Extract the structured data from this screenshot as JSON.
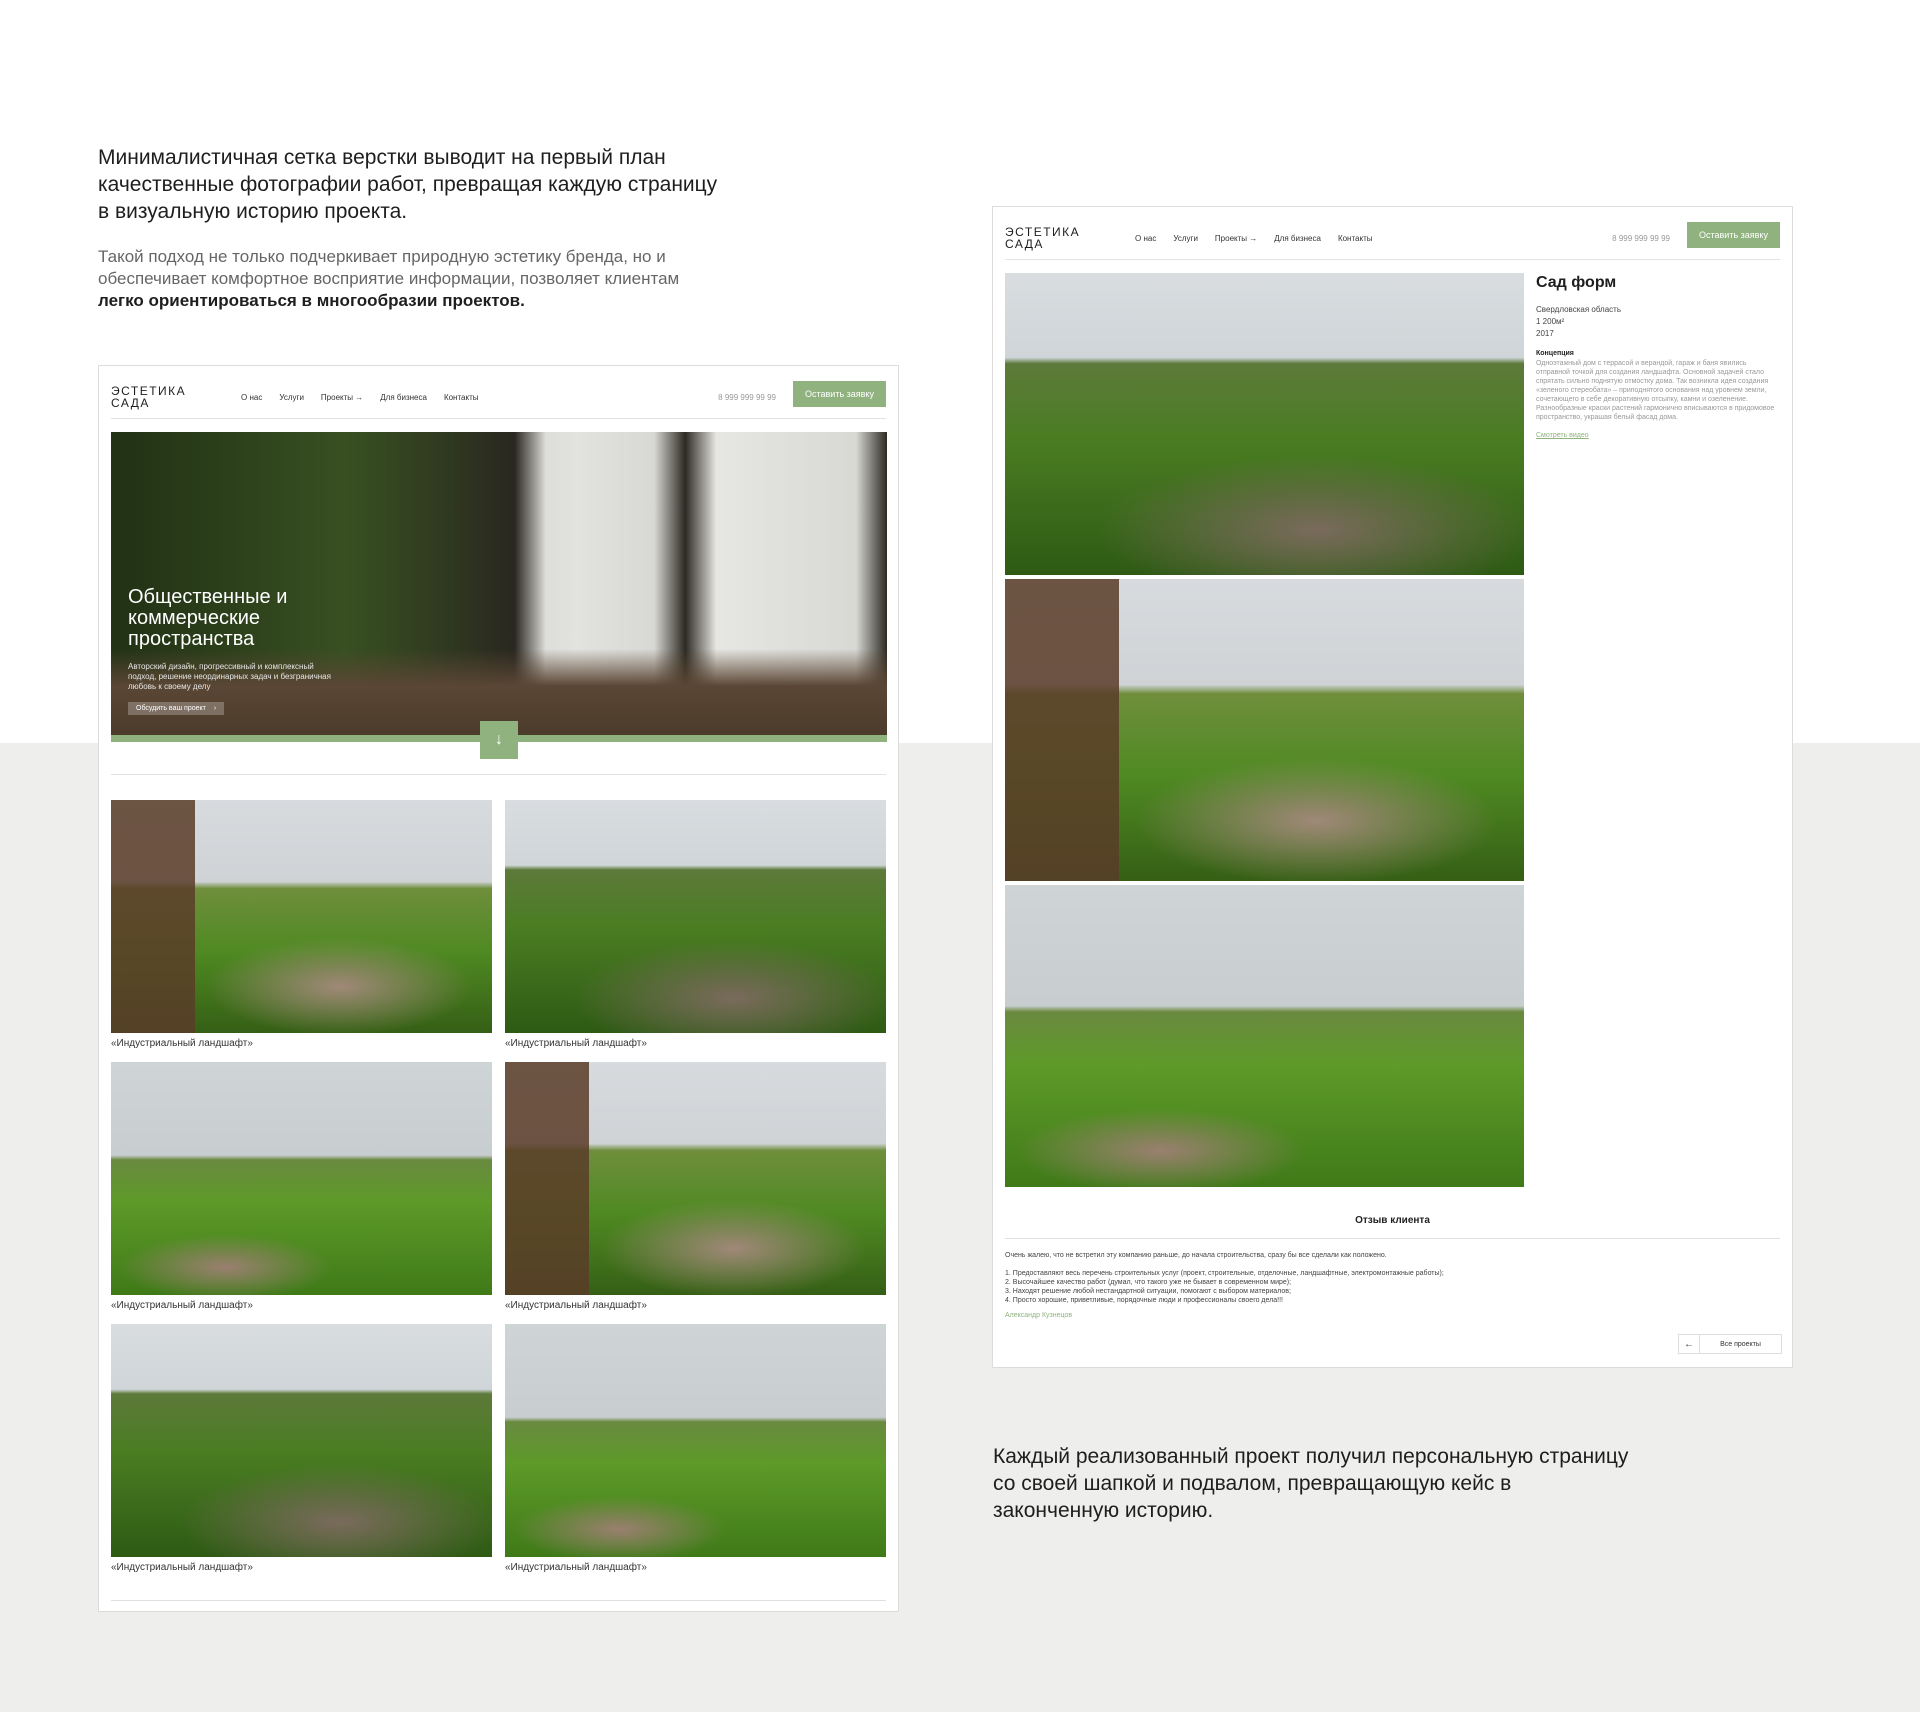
{
  "intro": {
    "lead": "Минималистичная сетка верстки выводит на первый план качественные фотографии работ, превращая каждую страницу в визуальную историю проекта.",
    "sub_prefix": "Такой подход не только подчеркивает природную эстетику бренда, но и обеспечивает комфортное восприятие информации, позволяет клиентам ",
    "sub_bold": "легко ориентироваться в многообразии проектов."
  },
  "outro": "Каждый реализованный проект получил персональную страницу со своей шапкой и подвалом, превращающую кейс в законченную историю.",
  "site": {
    "logo_line1": "ЭСТЕТИКА",
    "logo_line2": "САДА",
    "nav": [
      "О нас",
      "Услуги",
      "Проекты →",
      "Для бизнеса",
      "Контакты"
    ],
    "phone": "8 999 999 99 99",
    "cta": "Оставить заявку"
  },
  "hero": {
    "title": "Общественные и коммерческие пространства",
    "desc": "Авторский дизайн, прогрессивный и комплексный подход, решение неординарных задач и безграничная любовь к своему делу",
    "button": "Обсудить ваш проект",
    "button_icon": "arrow-right-icon",
    "scroll_icon": "arrow-down-icon"
  },
  "gallery": [
    {
      "caption": "«Индустриальный ландшафт»"
    },
    {
      "caption": "«Индустриальный ландшафт»"
    },
    {
      "caption": "«Индустриальный ландшафт»"
    },
    {
      "caption": "«Индустриальный ландшафт»"
    },
    {
      "caption": "«Индустриальный ландшафт»"
    },
    {
      "caption": "«Индустриальный ландшафт»"
    }
  ],
  "project": {
    "title": "Сад форм",
    "region": "Свердловская область",
    "area": "1 200м²",
    "year": "2017",
    "concept_heading": "Концепция",
    "concept_text": "Одноэтажный дом с террасой и верандой, гараж и баня явились отправной точкой для создания ландшафта. Основной задачей стало спрятать сильно поднятую отмостку дома. Так возникла идея создания «зеленого стереобата» – приподнятого основания над уровнем земли, сочетающего в себе декоративную отсыпку, камни и озеленение. Разнообразные краски растений гармонично вписываются в придомовое пространство, украшая белый фасад дома.",
    "video_link": "Смотреть видео"
  },
  "review": {
    "title": "Отзыв клиента",
    "intro": "Очень жалею, что не встретил эту компанию раньше, до начала строительства, сразу бы все сделали как положено.",
    "points": [
      "1. Предоставляют весь перечень строительных услуг (проект, строительные, отделочные, ландшафтные, электромонтажные работы);",
      "2. Высочайшее качество работ (думал, что такого уже не бывает в современном мире);",
      "3. Находят решение любой нестандартной ситуации, помогают с выбором материалов;",
      "4. Просто хорошие, приветливые, порядочные люди и профессионалы своего дела!!!"
    ],
    "author": "Александр Кузнецов",
    "back_icon": "arrow-left-icon",
    "all_projects": "Все проекты"
  },
  "colors": {
    "accent": "#8fb27e",
    "band": "#eeeeec"
  }
}
